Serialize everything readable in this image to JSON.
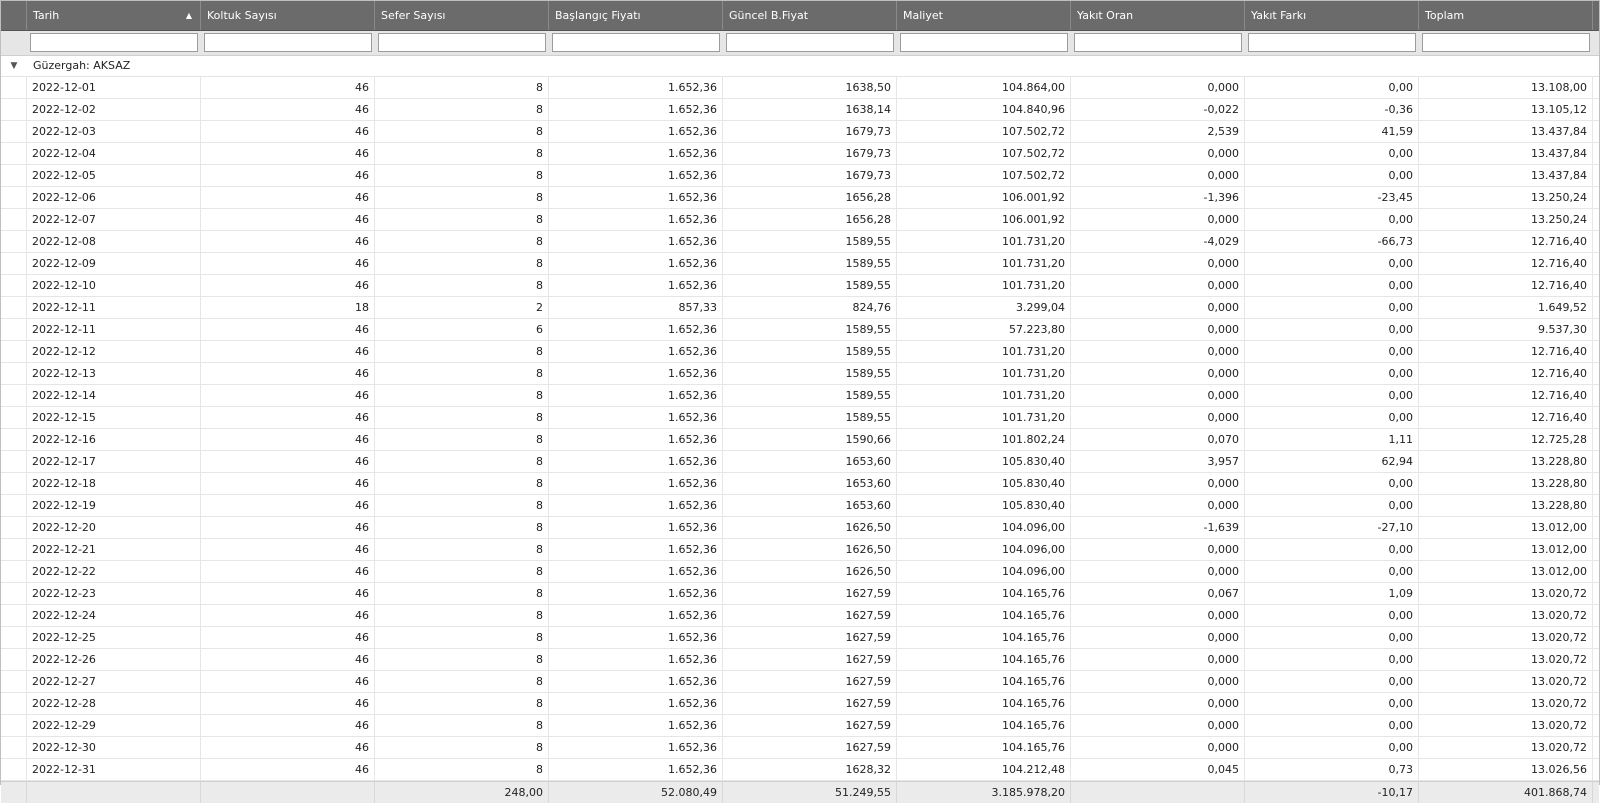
{
  "columns": [
    {
      "key": "tarih",
      "label": "Tarih"
    },
    {
      "key": "koltuk",
      "label": "Koltuk Sayısı"
    },
    {
      "key": "sefer",
      "label": "Sefer Sayısı"
    },
    {
      "key": "baslangic",
      "label": "Başlangıç Fiyatı"
    },
    {
      "key": "guncel",
      "label": "Güncel B.Fiyat"
    },
    {
      "key": "maliyet",
      "label": "Maliyet"
    },
    {
      "key": "yakit_oran",
      "label": "Yakıt Oran"
    },
    {
      "key": "yakit_farki",
      "label": "Yakıt Farkı"
    },
    {
      "key": "toplam",
      "label": "Toplam"
    }
  ],
  "group": {
    "label": "Güzergah: AKSAZ"
  },
  "rows": [
    [
      "2022-12-01",
      "46",
      "8",
      "1.652,36",
      "1638,50",
      "104.864,00",
      "0,000",
      "0,00",
      "13.108,00"
    ],
    [
      "2022-12-02",
      "46",
      "8",
      "1.652,36",
      "1638,14",
      "104.840,96",
      "-0,022",
      "-0,36",
      "13.105,12"
    ],
    [
      "2022-12-03",
      "46",
      "8",
      "1.652,36",
      "1679,73",
      "107.502,72",
      "2,539",
      "41,59",
      "13.437,84"
    ],
    [
      "2022-12-04",
      "46",
      "8",
      "1.652,36",
      "1679,73",
      "107.502,72",
      "0,000",
      "0,00",
      "13.437,84"
    ],
    [
      "2022-12-05",
      "46",
      "8",
      "1.652,36",
      "1679,73",
      "107.502,72",
      "0,000",
      "0,00",
      "13.437,84"
    ],
    [
      "2022-12-06",
      "46",
      "8",
      "1.652,36",
      "1656,28",
      "106.001,92",
      "-1,396",
      "-23,45",
      "13.250,24"
    ],
    [
      "2022-12-07",
      "46",
      "8",
      "1.652,36",
      "1656,28",
      "106.001,92",
      "0,000",
      "0,00",
      "13.250,24"
    ],
    [
      "2022-12-08",
      "46",
      "8",
      "1.652,36",
      "1589,55",
      "101.731,20",
      "-4,029",
      "-66,73",
      "12.716,40"
    ],
    [
      "2022-12-09",
      "46",
      "8",
      "1.652,36",
      "1589,55",
      "101.731,20",
      "0,000",
      "0,00",
      "12.716,40"
    ],
    [
      "2022-12-10",
      "46",
      "8",
      "1.652,36",
      "1589,55",
      "101.731,20",
      "0,000",
      "0,00",
      "12.716,40"
    ],
    [
      "2022-12-11",
      "18",
      "2",
      "857,33",
      "824,76",
      "3.299,04",
      "0,000",
      "0,00",
      "1.649,52"
    ],
    [
      "2022-12-11",
      "46",
      "6",
      "1.652,36",
      "1589,55",
      "57.223,80",
      "0,000",
      "0,00",
      "9.537,30"
    ],
    [
      "2022-12-12",
      "46",
      "8",
      "1.652,36",
      "1589,55",
      "101.731,20",
      "0,000",
      "0,00",
      "12.716,40"
    ],
    [
      "2022-12-13",
      "46",
      "8",
      "1.652,36",
      "1589,55",
      "101.731,20",
      "0,000",
      "0,00",
      "12.716,40"
    ],
    [
      "2022-12-14",
      "46",
      "8",
      "1.652,36",
      "1589,55",
      "101.731,20",
      "0,000",
      "0,00",
      "12.716,40"
    ],
    [
      "2022-12-15",
      "46",
      "8",
      "1.652,36",
      "1589,55",
      "101.731,20",
      "0,000",
      "0,00",
      "12.716,40"
    ],
    [
      "2022-12-16",
      "46",
      "8",
      "1.652,36",
      "1590,66",
      "101.802,24",
      "0,070",
      "1,11",
      "12.725,28"
    ],
    [
      "2022-12-17",
      "46",
      "8",
      "1.652,36",
      "1653,60",
      "105.830,40",
      "3,957",
      "62,94",
      "13.228,80"
    ],
    [
      "2022-12-18",
      "46",
      "8",
      "1.652,36",
      "1653,60",
      "105.830,40",
      "0,000",
      "0,00",
      "13.228,80"
    ],
    [
      "2022-12-19",
      "46",
      "8",
      "1.652,36",
      "1653,60",
      "105.830,40",
      "0,000",
      "0,00",
      "13.228,80"
    ],
    [
      "2022-12-20",
      "46",
      "8",
      "1.652,36",
      "1626,50",
      "104.096,00",
      "-1,639",
      "-27,10",
      "13.012,00"
    ],
    [
      "2022-12-21",
      "46",
      "8",
      "1.652,36",
      "1626,50",
      "104.096,00",
      "0,000",
      "0,00",
      "13.012,00"
    ],
    [
      "2022-12-22",
      "46",
      "8",
      "1.652,36",
      "1626,50",
      "104.096,00",
      "0,000",
      "0,00",
      "13.012,00"
    ],
    [
      "2022-12-23",
      "46",
      "8",
      "1.652,36",
      "1627,59",
      "104.165,76",
      "0,067",
      "1,09",
      "13.020,72"
    ],
    [
      "2022-12-24",
      "46",
      "8",
      "1.652,36",
      "1627,59",
      "104.165,76",
      "0,000",
      "0,00",
      "13.020,72"
    ],
    [
      "2022-12-25",
      "46",
      "8",
      "1.652,36",
      "1627,59",
      "104.165,76",
      "0,000",
      "0,00",
      "13.020,72"
    ],
    [
      "2022-12-26",
      "46",
      "8",
      "1.652,36",
      "1627,59",
      "104.165,76",
      "0,000",
      "0,00",
      "13.020,72"
    ],
    [
      "2022-12-27",
      "46",
      "8",
      "1.652,36",
      "1627,59",
      "104.165,76",
      "0,000",
      "0,00",
      "13.020,72"
    ],
    [
      "2022-12-28",
      "46",
      "8",
      "1.652,36",
      "1627,59",
      "104.165,76",
      "0,000",
      "0,00",
      "13.020,72"
    ],
    [
      "2022-12-29",
      "46",
      "8",
      "1.652,36",
      "1627,59",
      "104.165,76",
      "0,000",
      "0,00",
      "13.020,72"
    ],
    [
      "2022-12-30",
      "46",
      "8",
      "1.652,36",
      "1627,59",
      "104.165,76",
      "0,000",
      "0,00",
      "13.020,72"
    ],
    [
      "2022-12-31",
      "46",
      "8",
      "1.652,36",
      "1628,32",
      "104.212,48",
      "0,045",
      "0,73",
      "13.026,56"
    ]
  ],
  "footer": [
    "",
    "",
    "248,00",
    "52.080,49",
    "51.249,55",
    "3.185.978,20",
    "",
    "-10,17",
    "401.868,74"
  ]
}
